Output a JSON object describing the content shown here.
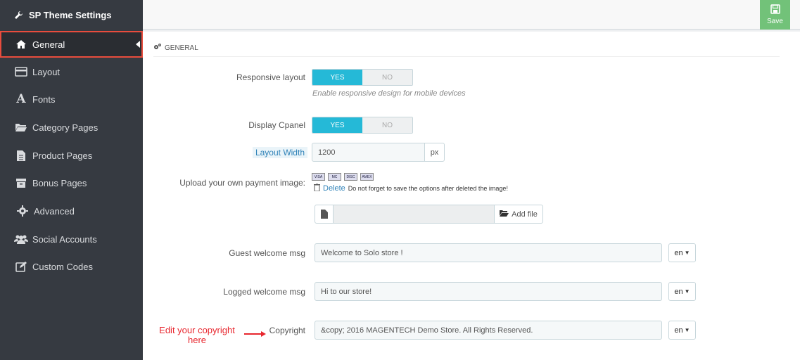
{
  "sidebar": {
    "title": "SP Theme Settings",
    "items": [
      {
        "label": "General",
        "icon": "home-icon"
      },
      {
        "label": "Layout",
        "icon": "layout-icon"
      },
      {
        "label": "Fonts",
        "icon": "font-icon"
      },
      {
        "label": "Category Pages",
        "icon": "folder-icon"
      },
      {
        "label": "Product Pages",
        "icon": "file-icon"
      },
      {
        "label": "Bonus Pages",
        "icon": "archive-icon"
      },
      {
        "label": "Advanced",
        "icon": "gear-icon"
      },
      {
        "label": "Social Accounts",
        "icon": "users-icon"
      },
      {
        "label": "Custom Codes",
        "icon": "edit-icon"
      }
    ]
  },
  "toolbar": {
    "save_label": "Save"
  },
  "panel": {
    "title": "GENERAL",
    "responsive": {
      "label": "Responsive layout",
      "yes": "YES",
      "no": "NO",
      "help": "Enable responsive design for mobile devices"
    },
    "cpanel": {
      "label": "Display Cpanel",
      "yes": "YES",
      "no": "NO"
    },
    "width": {
      "label": "Layout Width",
      "value": "1200",
      "unit": "px"
    },
    "payment": {
      "label": "Upload your own payment image:",
      "cards": [
        "VISA",
        "MC",
        "DISC",
        "AMEX"
      ],
      "delete": "Delete",
      "delete_note": "Do not forget to save the options after deleted the image!",
      "add_file": "Add file"
    },
    "guest": {
      "label": "Guest welcome msg",
      "value": "Welcome to Solo store !",
      "lang": "en"
    },
    "logged": {
      "label": "Logged welcome msg",
      "value": "Hi to our store!",
      "lang": "en"
    },
    "copyright": {
      "label": "Copyright",
      "value": "&copy; 2016 MAGENTECH Demo Store. All Rights Reserved.",
      "lang": "en",
      "annotation_line1": "Edit your copyright",
      "annotation_line2": "here"
    }
  },
  "colors": {
    "sidebar": "#363a41",
    "accent": "#25b9d7",
    "save": "#72c279",
    "active_border": "#e84c3d"
  }
}
